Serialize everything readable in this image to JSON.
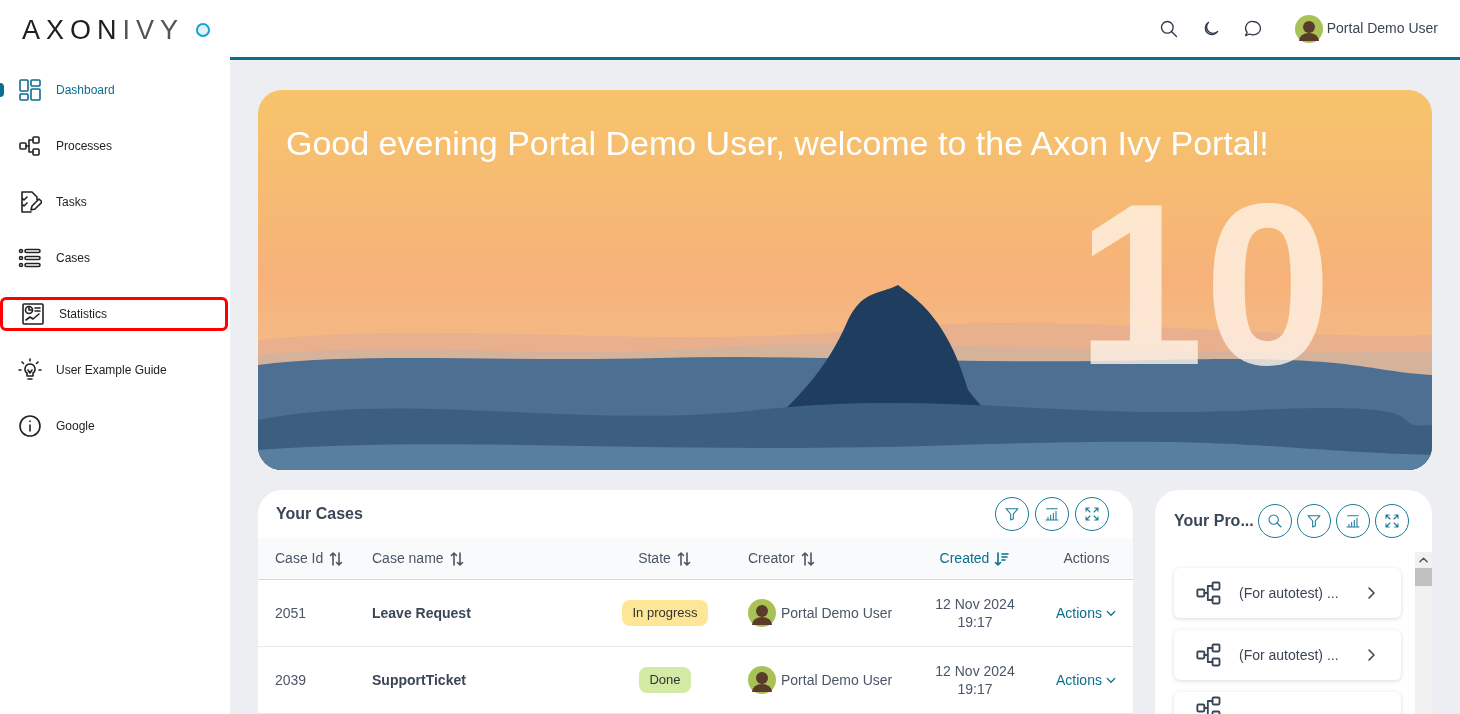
{
  "logo": {
    "text": "AXON",
    "text2": "IVY"
  },
  "sidebar": {
    "items": [
      {
        "label": "Dashboard",
        "selected": true,
        "highlighted": false
      },
      {
        "label": "Processes",
        "selected": false,
        "highlighted": false
      },
      {
        "label": "Tasks",
        "selected": false,
        "highlighted": false
      },
      {
        "label": "Cases",
        "selected": false,
        "highlighted": false
      },
      {
        "label": "Statistics",
        "selected": false,
        "highlighted": true
      },
      {
        "label": "User Example Guide",
        "selected": false,
        "highlighted": false
      },
      {
        "label": "Google",
        "selected": false,
        "highlighted": false
      }
    ]
  },
  "header": {
    "user_name": "Portal Demo User"
  },
  "banner": {
    "greeting": "Good evening Portal Demo User, welcome to the Axon Ivy Portal!",
    "big_number": "10"
  },
  "cases_widget": {
    "title": "Your Cases",
    "columns": [
      {
        "label": "Case Id",
        "sorted": false
      },
      {
        "label": "Case name",
        "sorted": false
      },
      {
        "label": "State",
        "sorted": false
      },
      {
        "label": "Creator",
        "sorted": false
      },
      {
        "label": "Created",
        "sorted": true
      },
      {
        "label": "Actions",
        "sorted": false
      }
    ],
    "rows": [
      {
        "id": "2051",
        "name": "Leave Request",
        "state": "In progress",
        "kind": "progress",
        "creator": "Portal Demo User",
        "date": "12 Nov 2024",
        "time": "19:17",
        "actions": "Actions"
      },
      {
        "id": "2039",
        "name": "SupportTicket",
        "state": "Done",
        "kind": "done",
        "creator": "Portal Demo User",
        "date": "12 Nov 2024",
        "time": "19:17",
        "actions": "Actions"
      }
    ]
  },
  "processes_widget": {
    "title": "Your Pro...",
    "items": [
      {
        "label": "(For autotest) ..."
      },
      {
        "label": "(For autotest) ..."
      },
      {
        "kind": "cut_off"
      }
    ]
  }
}
